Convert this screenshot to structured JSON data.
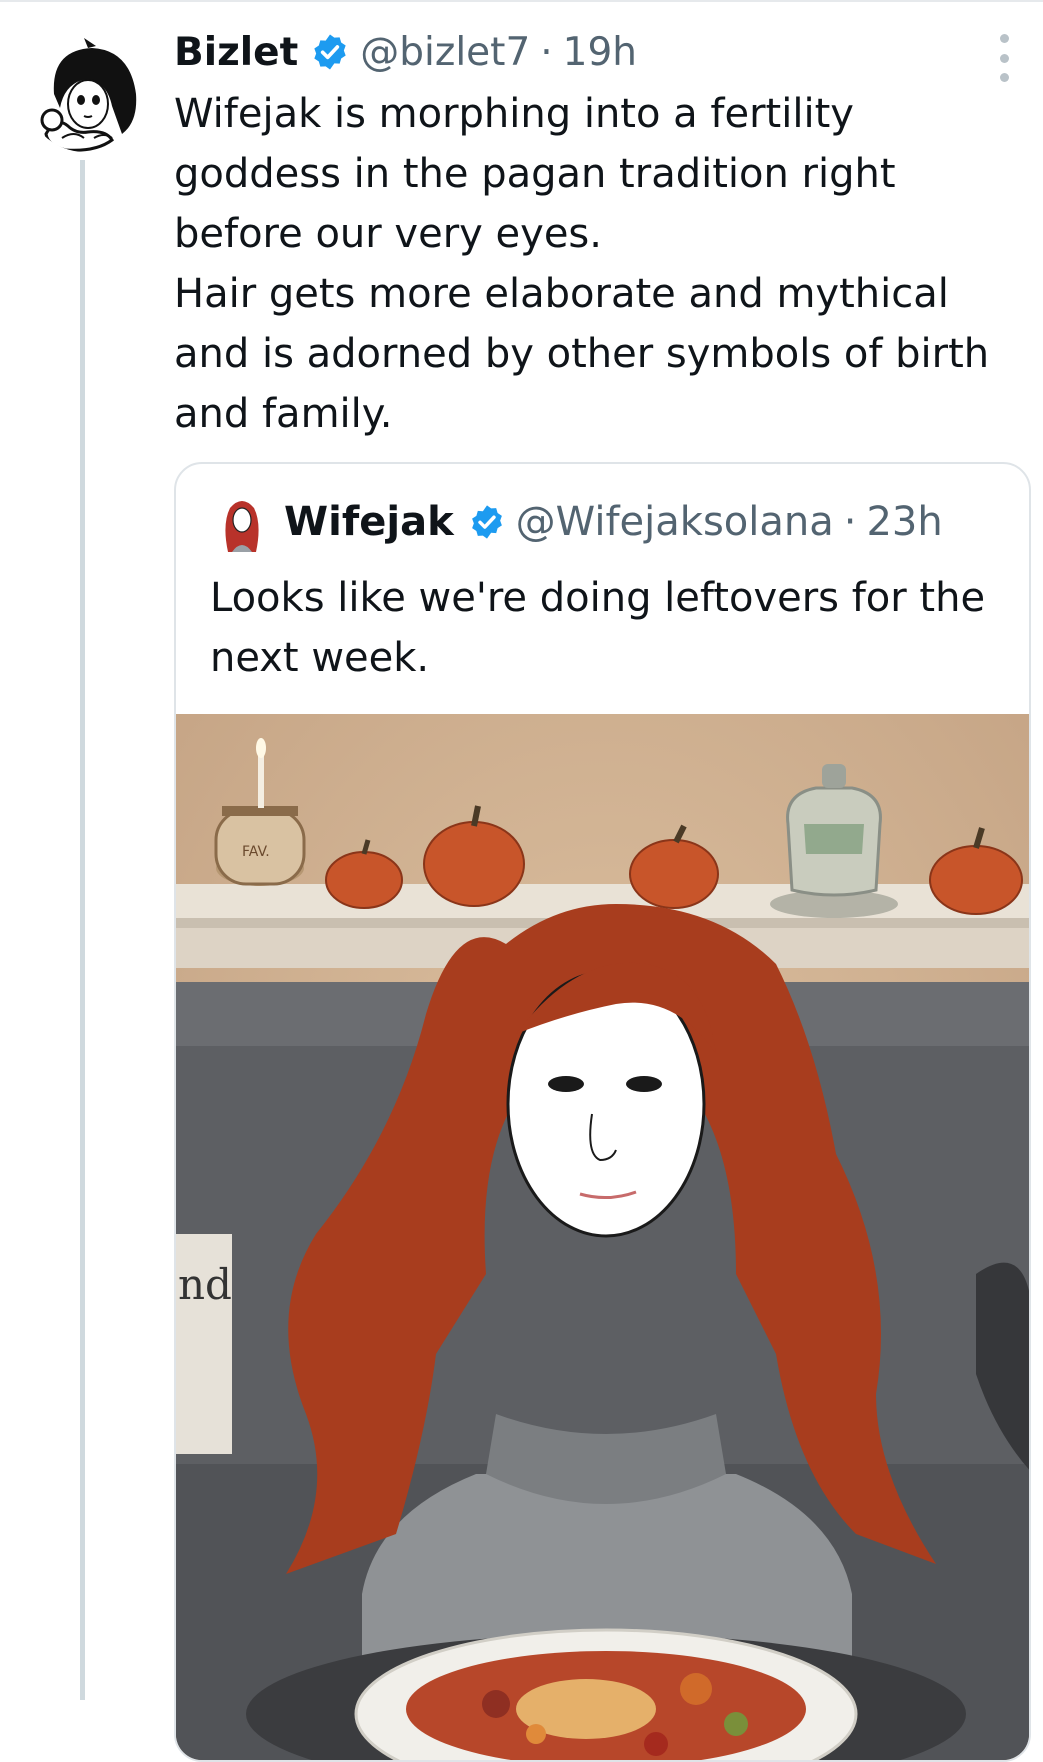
{
  "tweet": {
    "display_name": "Bizlet",
    "handle": "@bizlet7",
    "separator": "·",
    "time": "19h",
    "avatar": "anime-character-avatar",
    "verified_icon": "verified-badge-icon",
    "more_icon": "more-vertical-icon",
    "text_lines": [
      "Wifejak is morphing into a fertility",
      "goddess in the pagan tradition right",
      "before our very eyes.",
      "Hair gets more elaborate and mythical",
      "and is adorned by other symbols of birth",
      "and family."
    ]
  },
  "quote": {
    "display_name": "Wifejak",
    "handle": "@Wifejaksolana",
    "separator": "·",
    "time": "23h",
    "avatar": "red-hair-woman-avatar",
    "text_lines": [
      "Looks like we're doing leftovers for the",
      "next week."
    ],
    "image": "illustration-red-haired-woman-with-plate-of-food-and-pumpkins",
    "image_text": {
      "candle_label": "FAV.",
      "pillow_text": "nd"
    }
  },
  "colors": {
    "verified": "#1d9bf0",
    "text_primary": "#0f1419",
    "text_secondary": "#536471",
    "border": "#dfe4e8",
    "thread_line": "#cfd9de"
  }
}
